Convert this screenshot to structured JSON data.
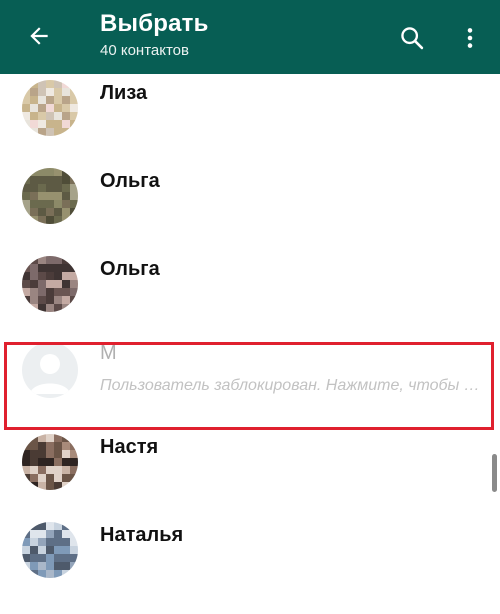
{
  "app_bar": {
    "title": "Выбрать",
    "subtitle": "40 контактов",
    "background_color": "#075e54",
    "icons": [
      "arrow-back-icon",
      "search-icon",
      "more-vert-icon"
    ]
  },
  "contacts": [
    {
      "name": "Лиза",
      "status": ""
    },
    {
      "name": "Ольга",
      "status": ""
    },
    {
      "name": "Ольга",
      "status": ""
    },
    {
      "name": "М",
      "status": "Пользователь заблокирован. Нажмите, чтобы разблокировать",
      "blocked": true
    },
    {
      "name": "Настя",
      "status": ""
    },
    {
      "name": "Наталья",
      "status": ""
    }
  ],
  "highlight_color": "#e0202e"
}
